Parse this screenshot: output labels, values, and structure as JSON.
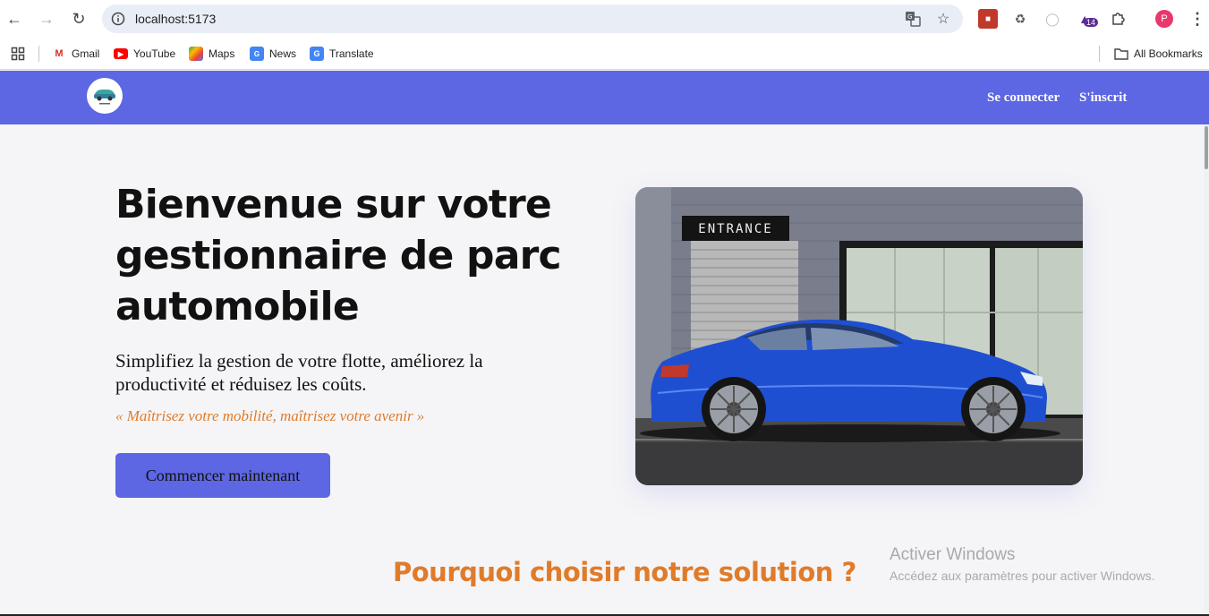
{
  "browser": {
    "url": "localhost:5173",
    "bookmarks": [
      {
        "label": "Gmail"
      },
      {
        "label": "YouTube"
      },
      {
        "label": "Maps"
      },
      {
        "label": "News"
      },
      {
        "label": "Translate"
      }
    ],
    "all_bookmarks": "All Bookmarks",
    "extension_badge": "14",
    "profile_initial": "P"
  },
  "app": {
    "nav": {
      "login": "Se connecter",
      "signup": "S'inscrit"
    },
    "hero": {
      "title": "Bienvenue sur votre gestionnaire de parc automobile",
      "subtitle": "Simplifiez la gestion de votre flotte, améliorez la productivité et réduisez les coûts.",
      "quote": "« Maîtrisez votre mobilité, maîtrisez votre avenir »",
      "cta": "Commencer maintenant",
      "image_sign": "ENTRANCE"
    },
    "section_title": "Pourquoi choisir notre solution ?"
  },
  "os_overlay": {
    "title": "Activer Windows",
    "subtitle": "Accédez aux paramètres pour activer Windows."
  },
  "colors": {
    "primary": "#5d66e3",
    "accent": "#e07b2a",
    "car_blue": "#1f4fd1"
  }
}
